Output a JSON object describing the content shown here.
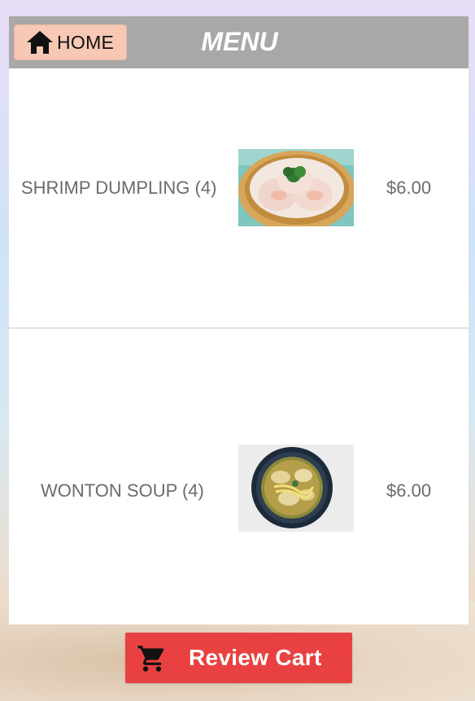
{
  "header": {
    "home_label": "HOME",
    "title": "MENU"
  },
  "menu": {
    "items": [
      {
        "name": "SHRIMP DUMPLING (4)",
        "price": "$6.00",
        "image_icon": "shrimp-dumpling-photo"
      },
      {
        "name": "WONTON SOUP (4)",
        "price": "$6.00",
        "image_icon": "wonton-soup-photo"
      }
    ]
  },
  "footer": {
    "cart_label": "Review Cart",
    "cart_icon": "shopping-cart-icon"
  },
  "colors": {
    "header_bg": "#a8a8a8",
    "home_button_bg": "#f7c8b4",
    "cart_button_bg": "#e94141",
    "text_gray": "#6b6b6b"
  }
}
